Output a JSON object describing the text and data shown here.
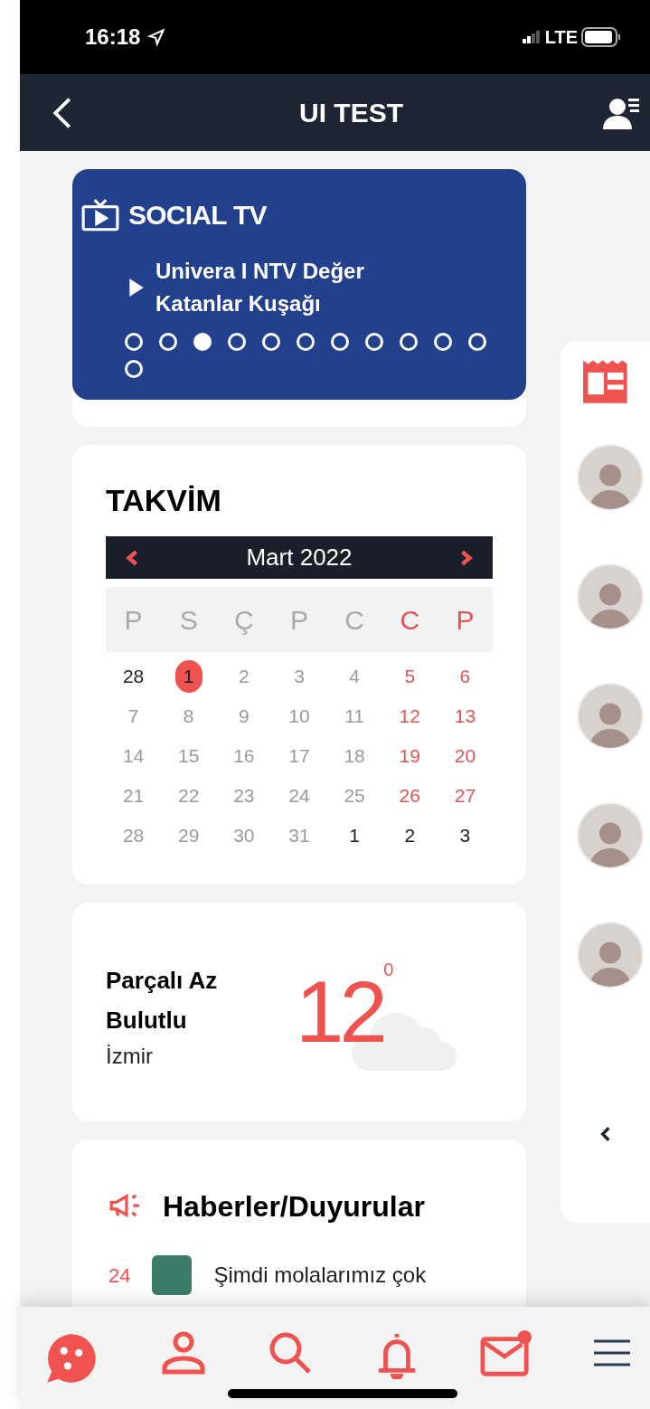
{
  "status_bar": {
    "time": "16:18",
    "network": "LTE"
  },
  "header": {
    "title": "UI TEST"
  },
  "social_tv": {
    "title": "SOCIAL TV",
    "video_title": "Univera I NTV Değer Katanlar Kuşağı",
    "dots": [
      {
        "selected": false
      },
      {
        "selected": false
      },
      {
        "selected": true
      },
      {
        "selected": false
      },
      {
        "selected": false
      },
      {
        "selected": false
      },
      {
        "selected": false
      },
      {
        "selected": false
      },
      {
        "selected": false
      },
      {
        "selected": false
      },
      {
        "selected": false
      },
      {
        "selected": false
      }
    ]
  },
  "calendar": {
    "title": "TAKVİM",
    "month": "Mart 2022",
    "weekdays": [
      {
        "label": "P",
        "weekend": false
      },
      {
        "label": "S",
        "weekend": false
      },
      {
        "label": "Ç",
        "weekend": false
      },
      {
        "label": "P",
        "weekend": false
      },
      {
        "label": "C",
        "weekend": false
      },
      {
        "label": "C",
        "weekend": true
      },
      {
        "label": "P",
        "weekend": true
      }
    ],
    "weeks": [
      [
        {
          "text": "28",
          "in_month": false,
          "selected": false
        },
        {
          "text": "1",
          "in_month": true,
          "selected": true
        },
        {
          "text": "2",
          "in_month": true,
          "selected": false
        },
        {
          "text": "3",
          "in_month": true,
          "selected": false
        },
        {
          "text": "4",
          "in_month": true,
          "selected": false
        },
        {
          "text": "5",
          "in_month": true,
          "selected": false
        },
        {
          "text": "6",
          "in_month": true,
          "selected": false
        }
      ],
      [
        {
          "text": "7",
          "in_month": true,
          "selected": false
        },
        {
          "text": "8",
          "in_month": true,
          "selected": false
        },
        {
          "text": "9",
          "in_month": true,
          "selected": false
        },
        {
          "text": "10",
          "in_month": true,
          "selected": false
        },
        {
          "text": "11",
          "in_month": true,
          "selected": false
        },
        {
          "text": "12",
          "in_month": true,
          "selected": false
        },
        {
          "text": "13",
          "in_month": true,
          "selected": false
        }
      ],
      [
        {
          "text": "14",
          "in_month": true,
          "selected": false
        },
        {
          "text": "15",
          "in_month": true,
          "selected": false
        },
        {
          "text": "16",
          "in_month": true,
          "selected": false
        },
        {
          "text": "17",
          "in_month": true,
          "selected": false
        },
        {
          "text": "18",
          "in_month": true,
          "selected": false
        },
        {
          "text": "19",
          "in_month": true,
          "selected": false
        },
        {
          "text": "20",
          "in_month": true,
          "selected": false
        }
      ],
      [
        {
          "text": "21",
          "in_month": true,
          "selected": false
        },
        {
          "text": "22",
          "in_month": true,
          "selected": false
        },
        {
          "text": "23",
          "in_month": true,
          "selected": false
        },
        {
          "text": "24",
          "in_month": true,
          "selected": false
        },
        {
          "text": "25",
          "in_month": true,
          "selected": false
        },
        {
          "text": "26",
          "in_month": true,
          "selected": false
        },
        {
          "text": "27",
          "in_month": true,
          "selected": false
        }
      ],
      [
        {
          "text": "28",
          "in_month": true,
          "selected": false
        },
        {
          "text": "29",
          "in_month": true,
          "selected": false
        },
        {
          "text": "30",
          "in_month": true,
          "selected": false
        },
        {
          "text": "31",
          "in_month": true,
          "selected": false
        },
        {
          "text": "1",
          "in_month": false,
          "selected": false
        },
        {
          "text": "2",
          "in_month": false,
          "selected": false
        },
        {
          "text": "3",
          "in_month": false,
          "selected": false
        }
      ]
    ]
  },
  "weather": {
    "condition": "Parçalı Az Bulutlu",
    "city": "İzmir",
    "temperature": "12",
    "degree": "0"
  },
  "news": {
    "title": "Haberler/Duyurular",
    "items": [
      {
        "day": "24",
        "text": "Şimdi molalarımız çok"
      }
    ]
  },
  "bottom_nav": {
    "mail_unread": true
  }
}
